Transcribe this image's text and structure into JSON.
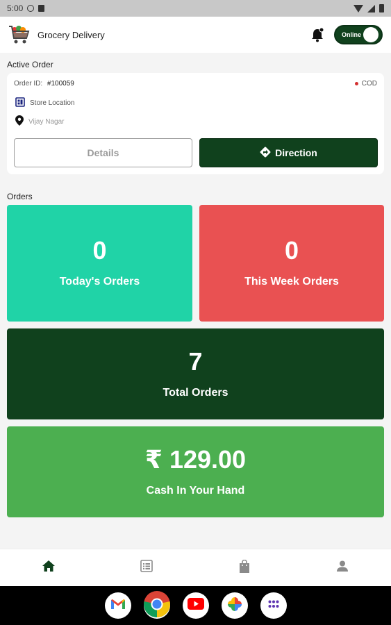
{
  "status_bar": {
    "time": "5:00"
  },
  "app_bar": {
    "title": "Grocery Delivery",
    "toggle_label": "Online"
  },
  "active_order": {
    "section_title": "Active Order",
    "order_id_label": "Order ID:",
    "order_id": "#100059",
    "payment_method": "COD",
    "store_label": "Store Location",
    "address": "Vijay Nagar",
    "details_button": "Details",
    "direction_button": "Direction"
  },
  "orders": {
    "section_title": "Orders",
    "today": {
      "value": "0",
      "label": "Today's Orders"
    },
    "week": {
      "value": "0",
      "label": "This Week Orders"
    },
    "total": {
      "value": "7",
      "label": "Total Orders"
    },
    "cash": {
      "value": "₹ 129.00",
      "label": "Cash In Your Hand"
    }
  },
  "colors": {
    "primary_dark_green": "#10411d",
    "teal": "#20d3a7",
    "red": "#e95152",
    "green": "#4caf50"
  },
  "icons": {
    "nav": [
      "home-icon",
      "list-icon",
      "shopping-bag-icon",
      "person-icon"
    ],
    "dock": [
      "gmail-icon",
      "chrome-icon",
      "youtube-icon",
      "photos-icon",
      "apps-icon"
    ]
  }
}
